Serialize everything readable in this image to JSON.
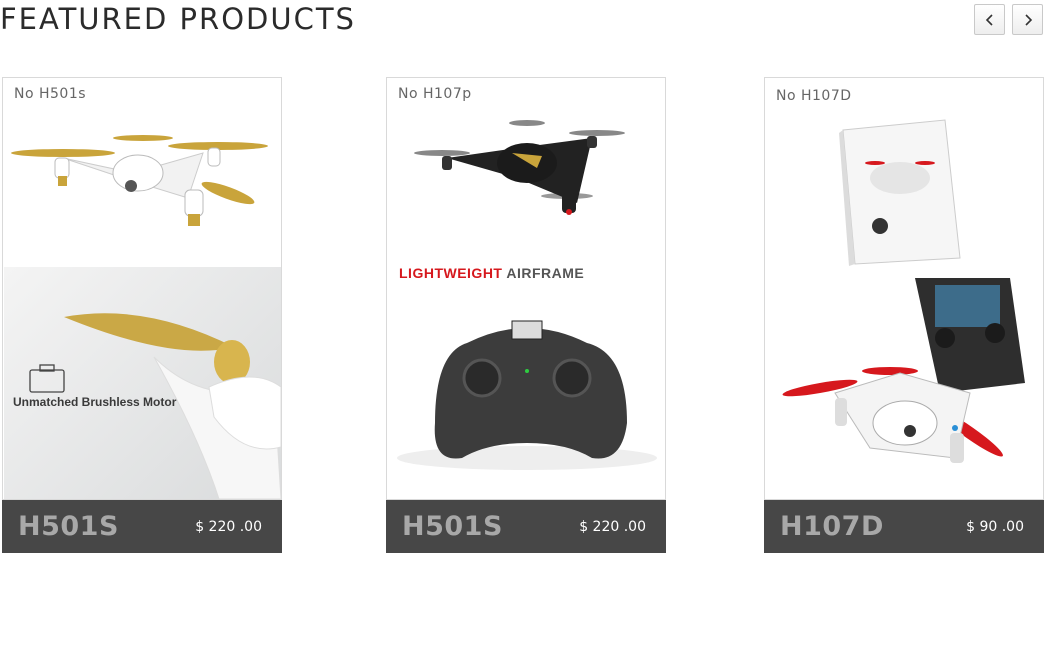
{
  "section": {
    "title": "FEATURED PRODUCTS"
  },
  "nav": {
    "prev_icon": "chevron-left-icon",
    "next_icon": "chevron-right-icon"
  },
  "products": [
    {
      "number": "No H501s",
      "model": "H501S",
      "price": "$ 220 .00",
      "caption": "Unmatched Brushless Motor"
    },
    {
      "number": "No H107p",
      "model": "H501S",
      "price": "$ 220 .00",
      "caption_highlight": "LIGHTWEIGHT",
      "caption_rest": " AIRFRAME"
    },
    {
      "number": "No H107D",
      "model": "H107D",
      "price": "$ 90 .00"
    }
  ],
  "colors": {
    "footer": "#474747",
    "model_text": "#a8a8a8",
    "accent_red": "#d6181d",
    "gold": "#c9a43b"
  }
}
